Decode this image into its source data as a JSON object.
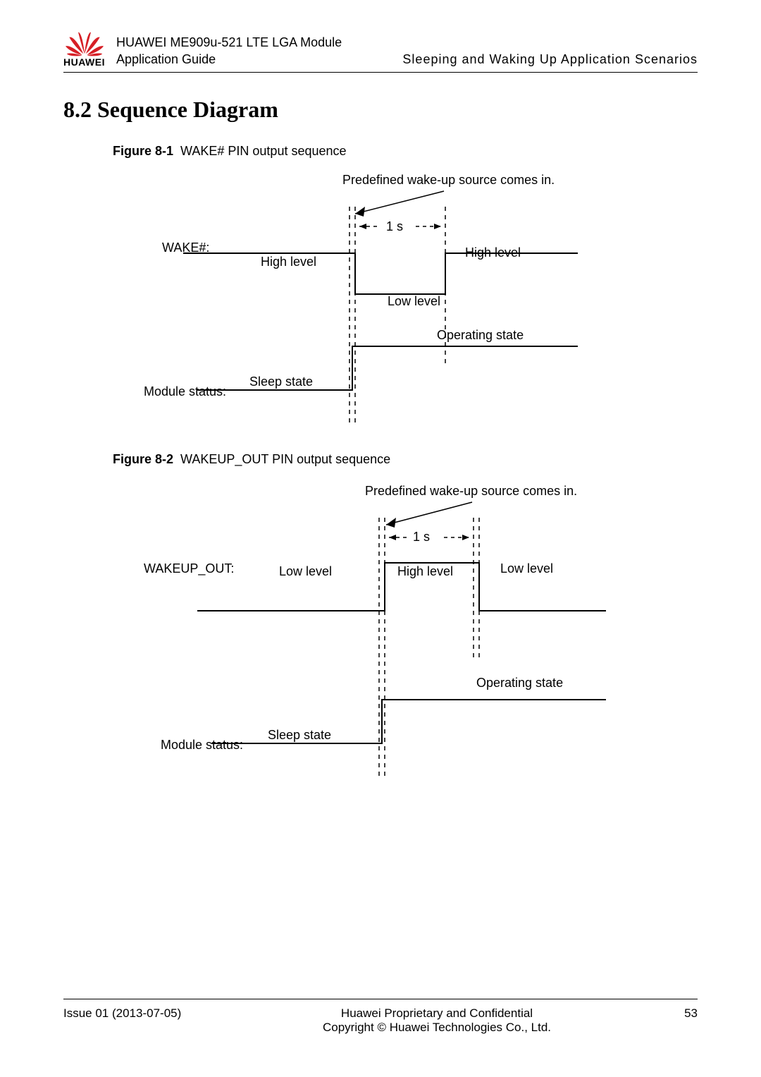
{
  "header": {
    "brand": "HUAWEI",
    "title_line1": "HUAWEI ME909u-521 LTE LGA Module",
    "title_line2_left": "Application Guide",
    "title_line2_right": "Sleeping and Waking Up Application Scenarios"
  },
  "section": {
    "number": "8.2",
    "title": "Sequence Diagram"
  },
  "figure1": {
    "label": "Figure 8-1",
    "caption": "WAKE# PIN output sequence",
    "top_note": "Predefined wake-up source comes in.",
    "signal": "WAKE#:",
    "high1": "High level",
    "high2": "High level",
    "low": "Low level",
    "pulse": "1 s",
    "module_label": "Module status:",
    "sleep": "Sleep state",
    "operating": "Operating state"
  },
  "figure2": {
    "label": "Figure 8-2",
    "caption": "WAKEUP_OUT PIN output sequence",
    "top_note": "Predefined wake-up source comes in.",
    "signal": "WAKEUP_OUT:",
    "low1": "Low level",
    "high": "High level",
    "low2": "Low level",
    "pulse": "1 s",
    "module_label": "Module status:",
    "sleep": "Sleep state",
    "operating": "Operating state"
  },
  "footer": {
    "issue": "Issue 01 (2013-07-05)",
    "line1": "Huawei Proprietary and Confidential",
    "line2": "Copyright © Huawei Technologies Co., Ltd.",
    "page": "53"
  }
}
